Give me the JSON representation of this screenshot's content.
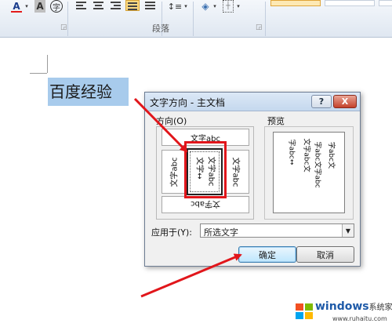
{
  "ribbon": {
    "group_label": "段落",
    "icons": [
      "font-color-icon",
      "char-shading-icon",
      "enclose-char-icon",
      "align-left-icon",
      "align-center-icon",
      "align-right-icon",
      "justify-icon",
      "distributed-icon",
      "line-spacing-icon",
      "shading-icon",
      "borders-icon"
    ]
  },
  "document": {
    "selected_text": "百度经验"
  },
  "dialog": {
    "title": "文字方向 - 主文档",
    "help_label": "?",
    "close_label": "X",
    "orientation_label": "方向(O)",
    "options": {
      "top": "文字abc",
      "left": "文字abc",
      "middle_col1": "文字abc",
      "middle_col2": "文字↔",
      "right": "文字abc",
      "bottom": "文字abc"
    },
    "preview_label": "预览",
    "preview_columns": [
      "字abc文",
      "字abc文字abc",
      "文字abc文",
      "字abc↔"
    ],
    "apply_to_label": "应用于(Y):",
    "apply_to_value": "所选文字",
    "ok_label": "确定",
    "cancel_label": "取消"
  },
  "watermark": {
    "brand": "windows",
    "brand_suffix": "系统家园",
    "url": "www.ruhaitu.com"
  },
  "colors": {
    "annotation": "#e1161b",
    "selection": "#a8cbec"
  }
}
